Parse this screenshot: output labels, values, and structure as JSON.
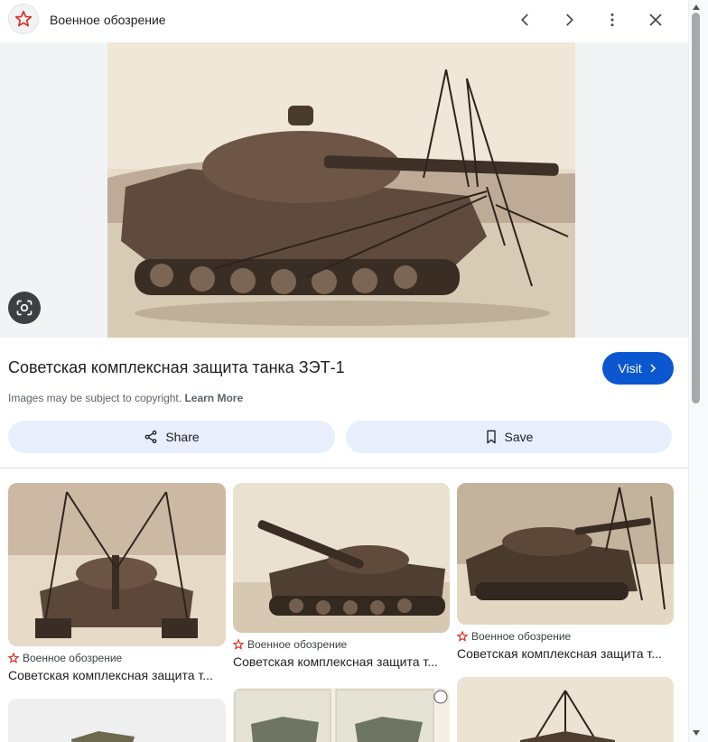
{
  "header": {
    "site_name": "Военное обозрение",
    "icons": {
      "site": "red-star-icon",
      "prev": "chevron-left-icon",
      "next": "chevron-right-icon",
      "more": "more-vert-icon",
      "close": "close-icon"
    }
  },
  "preview": {
    "lens_icon": "google-lens-icon"
  },
  "result": {
    "title": "Советская комплексная защита танка ЗЭТ-1",
    "visit_label": "Visit",
    "copyright_text": "Images may be subject to copyright.",
    "learn_more": "Learn More",
    "share_label": "Share",
    "save_label": "Save"
  },
  "related": [
    {
      "source": "Военное обозрение",
      "caption": "Советская комплексная защита т..."
    },
    {
      "source": "Военное обозрение",
      "caption": "Советская комплексная защита т..."
    },
    {
      "source": "Военное обозрение",
      "caption": "Советская комплексная защита т..."
    }
  ],
  "colors": {
    "accent": "#0b57d0",
    "star": "#d93025",
    "button_bg": "#e8eefc",
    "sepia": "#e8dcc8"
  }
}
